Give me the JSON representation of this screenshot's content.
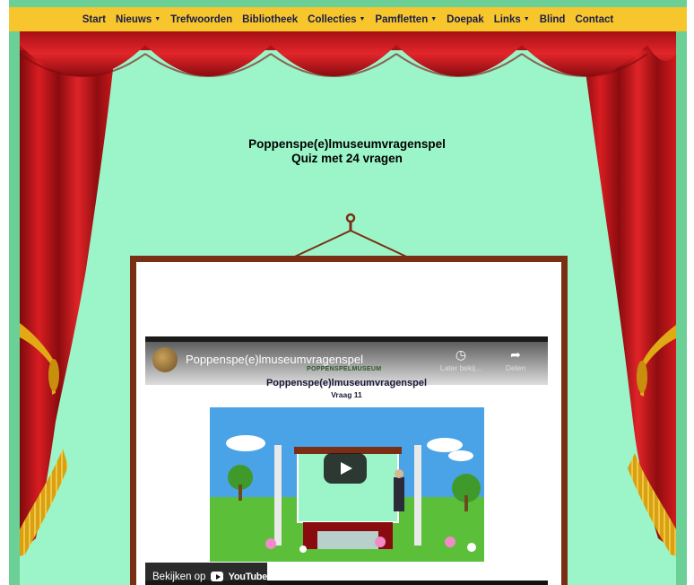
{
  "nav": {
    "items": [
      {
        "label": "Start",
        "dropdown": false
      },
      {
        "label": "Nieuws",
        "dropdown": true
      },
      {
        "label": "Trefwoorden",
        "dropdown": false
      },
      {
        "label": "Bibliotheek",
        "dropdown": false
      },
      {
        "label": "Collecties",
        "dropdown": true
      },
      {
        "label": "Pamfletten",
        "dropdown": true
      },
      {
        "label": "Doepak",
        "dropdown": false
      },
      {
        "label": "Links",
        "dropdown": true
      },
      {
        "label": "Blind",
        "dropdown": false
      },
      {
        "label": "Contact",
        "dropdown": false
      }
    ]
  },
  "page": {
    "title_line1": "Poppenspe(e)lmuseumvragenspel",
    "title_line2": "Quiz met 24 vragen"
  },
  "video": {
    "channel_title": "Poppenspe(e)lmuseumvragenspel",
    "watch_later_label": "Later bekij...",
    "share_label": "Delen",
    "logo_text": "POPPENSPELMUSEUM",
    "inner_title": "Poppenspe(e)lmuseumvragenspel",
    "inner_subtitle": "Vraag 11",
    "watch_on_label": "Bekijken op",
    "youtube_label": "YouTube"
  },
  "colors": {
    "nav_bg": "#f6c62c",
    "stage_bg": "#9cf5c8",
    "frame_bg": "#6ccf95",
    "curtain_red": "#c8161b",
    "fringe_gold": "#e8b21a",
    "picture_frame": "#7a2f14"
  },
  "icons": {
    "clock": "clock-icon",
    "share": "share-icon",
    "play": "play-icon",
    "youtube": "youtube-logo-icon",
    "dropdown": "caret-down-icon"
  }
}
